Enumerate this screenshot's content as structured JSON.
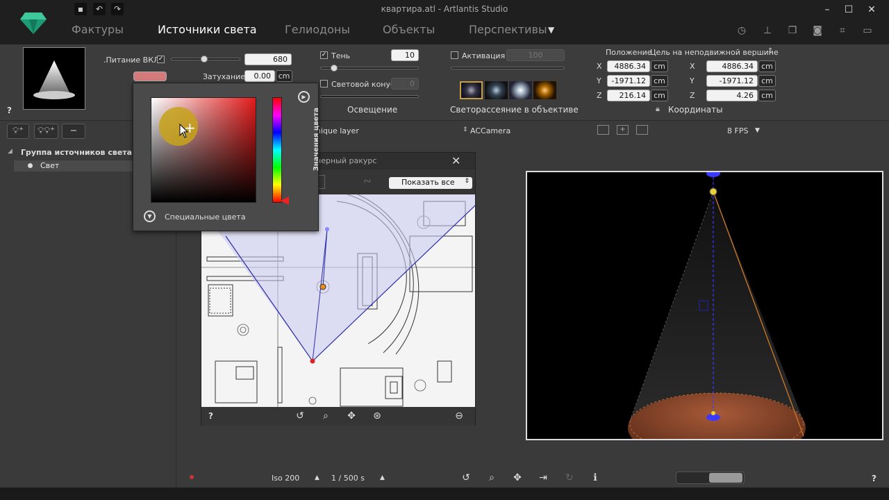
{
  "window": {
    "title": "квартира.atl - Artlantis Studio"
  },
  "tabs": [
    {
      "label": "Фактуры"
    },
    {
      "label": "Источники света"
    },
    {
      "label": "Гелиодоны"
    },
    {
      "label": "Объекты"
    },
    {
      "label": "Перспективы"
    }
  ],
  "help_label": "?",
  "light": {
    "power_label": ".Питание ВКЛ",
    "power_value": "680",
    "attenuation_label": "Затухание",
    "attenuation_value": "0.00",
    "attenuation_unit": "cm",
    "color_swatch": "#d47a7a"
  },
  "shadow": {
    "shadow_label": "Тень",
    "shadow_value": "10",
    "cone_label": "Световой конус",
    "cone_value": "0",
    "section": "Освещение"
  },
  "flare": {
    "activation_label": "Активация",
    "activation_value": "100",
    "section": "Светорассеяние в объективе"
  },
  "position": {
    "header": "Положение",
    "target_header": "Цель на неподвижной вершине",
    "coords_label": "Координаты",
    "unit": "cm",
    "pos": [
      {
        "axis": "X",
        "value": "4886.34"
      },
      {
        "axis": "Y",
        "value": "-1971.12"
      },
      {
        "axis": "Z",
        "value": "216.14"
      }
    ],
    "target": [
      {
        "axis": "X",
        "value": "4886.34"
      },
      {
        "axis": "Y",
        "value": "-1971.12"
      },
      {
        "axis": "Z",
        "value": "4.26"
      }
    ]
  },
  "sidebar": {
    "group_label": "Группа источников света",
    "item_label": "Свет",
    "minus_label": "−"
  },
  "view_toolbar": {
    "layer_label": "nique layer",
    "camera_label": "ACCamera",
    "fps_label": "8 FPS"
  },
  "plan_window": {
    "title": "нерный ракурс",
    "show_all": "Показать все",
    "help": "?"
  },
  "color_popup": {
    "vertical_label": "Значения цвета",
    "special_label": "Специальные цвета"
  },
  "bottom": {
    "iso": "Iso  200",
    "shutter": "1 /  500 s",
    "help": "?"
  }
}
